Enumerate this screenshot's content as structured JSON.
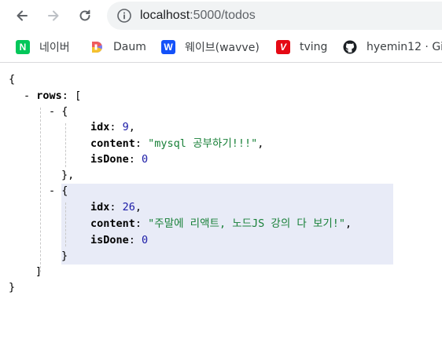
{
  "browser": {
    "url_host": "localhost",
    "url_path": ":5000/todos",
    "icons": {
      "back": "arrow-left-icon",
      "forward": "arrow-right-icon",
      "reload": "reload-icon",
      "info": "info-circle-icon"
    }
  },
  "bookmarks": [
    {
      "label": "네이버",
      "fav_text": "N",
      "fav_color": "#03c75a",
      "icon": "naver-icon"
    },
    {
      "label": "Daum",
      "fav_text": "D",
      "fav_color": "#7a7cf2",
      "icon": "daum-icon"
    },
    {
      "label": "웨이브(wavve)",
      "fav_text": "W",
      "fav_color": "#1351f9",
      "icon": "wavve-icon"
    },
    {
      "label": "tving",
      "fav_text": "V",
      "fav_color": "#e50914",
      "icon": "tving-icon"
    },
    {
      "label": "hyemin12 · Gi",
      "fav_text": "",
      "fav_color": "#000000",
      "icon": "github-icon"
    }
  ],
  "json": {
    "open_brace": "{",
    "close_brace": "}",
    "rows_key": "rows",
    "rows_open": "[",
    "rows_close": "]",
    "collapse_symbol": "-",
    "rows": [
      {
        "idx_key": "idx",
        "idx": "9",
        "content_key": "content",
        "content": "\"mysql 공부하기!!!\"",
        "isDone_key": "isDone",
        "isDone": "0"
      },
      {
        "idx_key": "idx",
        "idx": "26",
        "content_key": "content",
        "content": "\"주말에 리액트, 노드JS 강의 다 보기!\"",
        "isDone_key": "isDone",
        "isDone": "0"
      }
    ]
  },
  "colors": {
    "highlight": "#e8ebf7",
    "string": "#188038",
    "number": "#1a1aa6"
  }
}
